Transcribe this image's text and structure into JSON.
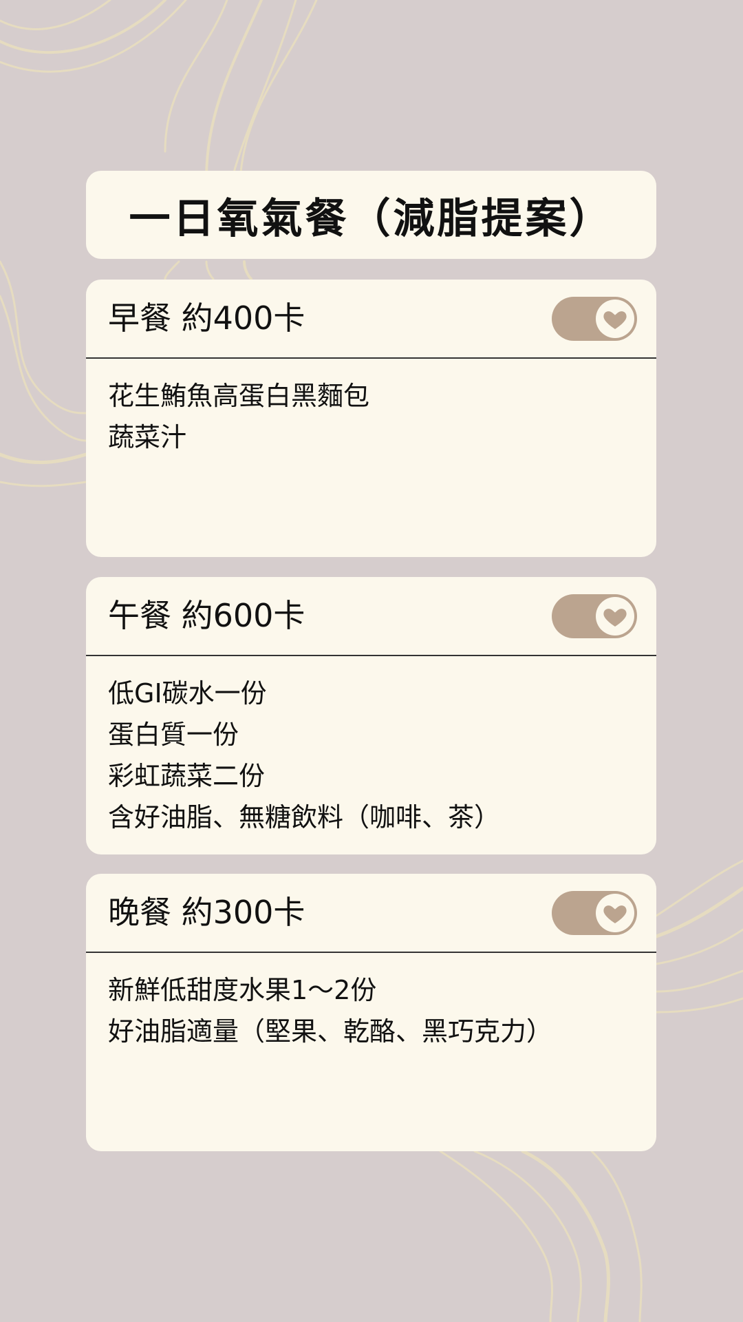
{
  "page": {
    "title": "一日氧氣餐（減脂提案）"
  },
  "colors": {
    "background": "#d6cdcd",
    "card": "#fcf8ec",
    "toggle": "#bba48f",
    "lines": "#e6dcc0"
  },
  "meals": [
    {
      "title": "早餐 約400卡",
      "icon": "heart-icon",
      "items": [
        "花生鮪魚高蛋白黑麵包",
        "蔬菜汁"
      ]
    },
    {
      "title": "午餐 約600卡",
      "icon": "heart-icon",
      "items": [
        "低GI碳水一份",
        "蛋白質一份",
        "彩虹蔬菜二份",
        "含好油脂、無糖飲料（咖啡、茶）"
      ]
    },
    {
      "title": "晚餐 約300卡",
      "icon": "heart-icon",
      "items": [
        "新鮮低甜度水果1～2份",
        "好油脂適量（堅果、乾酪、黑巧克力）"
      ]
    }
  ]
}
